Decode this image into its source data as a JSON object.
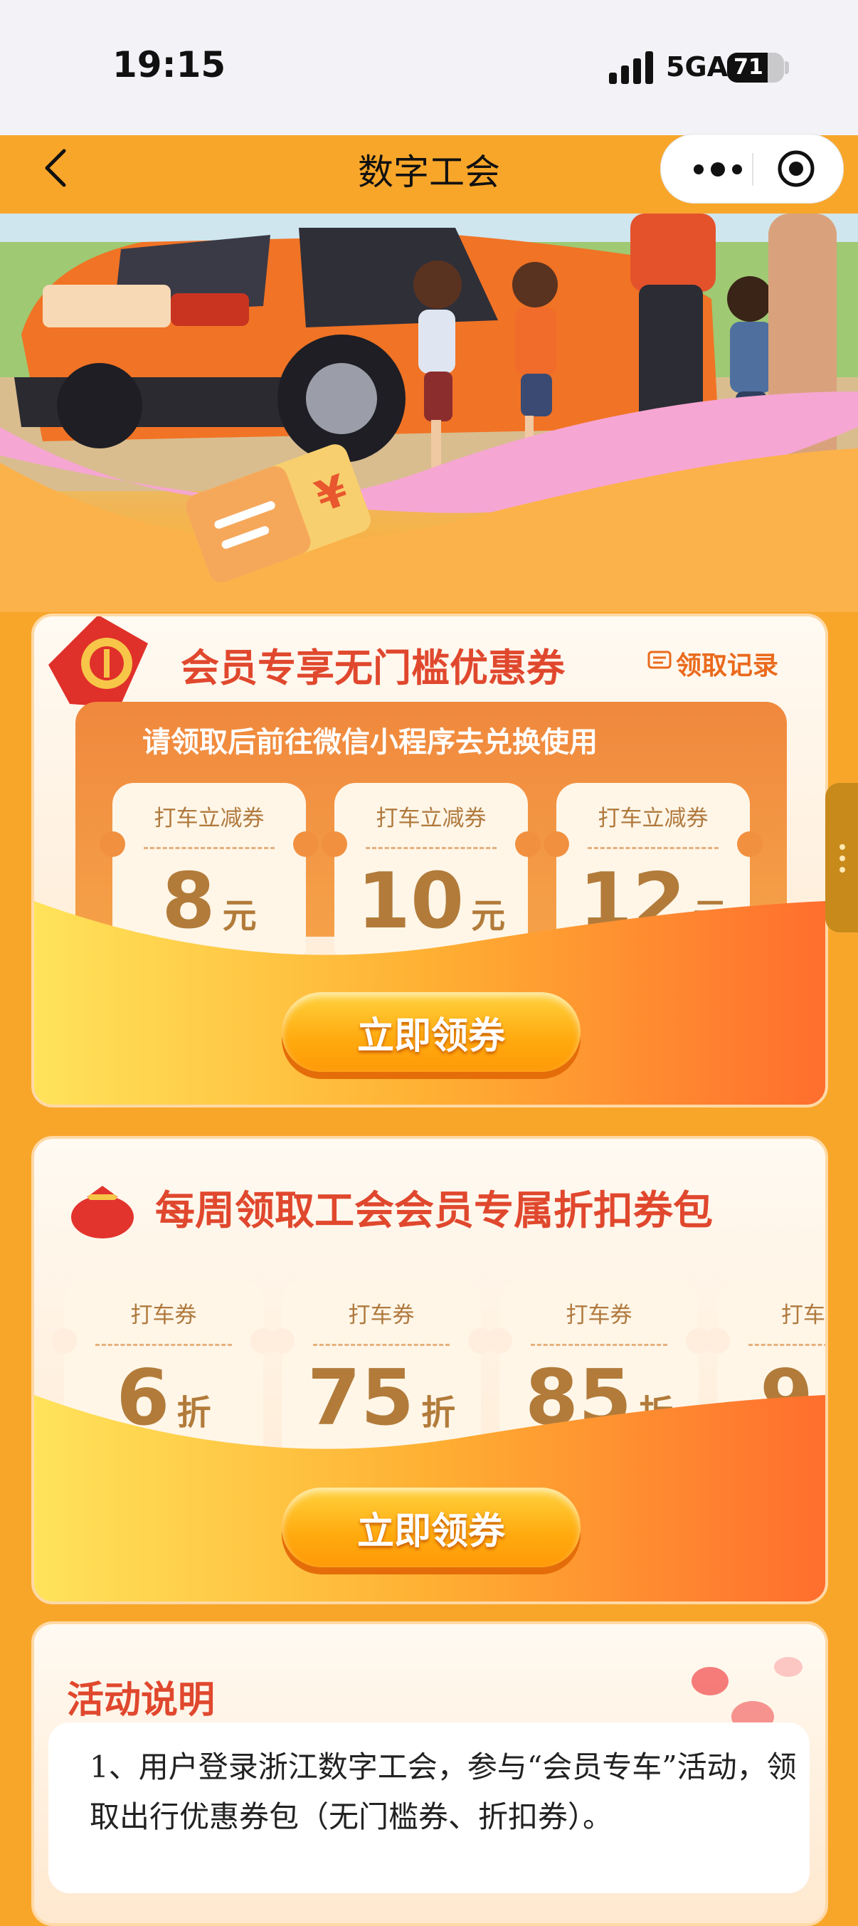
{
  "status_bar": {
    "time": "19:15",
    "network": "5GA",
    "battery": "71",
    "battery_level": 0.71
  },
  "nav": {
    "title": "数字工会"
  },
  "panel1": {
    "title": "会员专享无门槛优惠券",
    "records_label": "领取记录",
    "hint": "请领取后前往微信小程序去兑换使用",
    "coupons": [
      {
        "label": "打车立减券",
        "value": "8",
        "unit": "元"
      },
      {
        "label": "打车立减券",
        "value": "10",
        "unit": "元"
      },
      {
        "label": "打车立减券",
        "value": "12",
        "unit": "元"
      }
    ],
    "button": "立即领券"
  },
  "panel2": {
    "title": "每周领取工会会员专属折扣券包",
    "coupons": [
      {
        "label": "打车券",
        "value": "6",
        "unit": "折"
      },
      {
        "label": "打车券",
        "value": "75",
        "unit": "折"
      },
      {
        "label": "打车券",
        "value": "85",
        "unit": "折"
      },
      {
        "label": "打车",
        "value": "9",
        "unit": ""
      }
    ],
    "button": "立即领券"
  },
  "panel3": {
    "title": "活动说明",
    "text": "1、用户登录浙江数字工会，参与“会员专车”活动，领取出行优惠券包（无门槛券、折扣券）。"
  },
  "colors": {
    "accent_red": "#e0482e",
    "orange": "#f8a62a",
    "coupon_text": "#b27b3a"
  }
}
